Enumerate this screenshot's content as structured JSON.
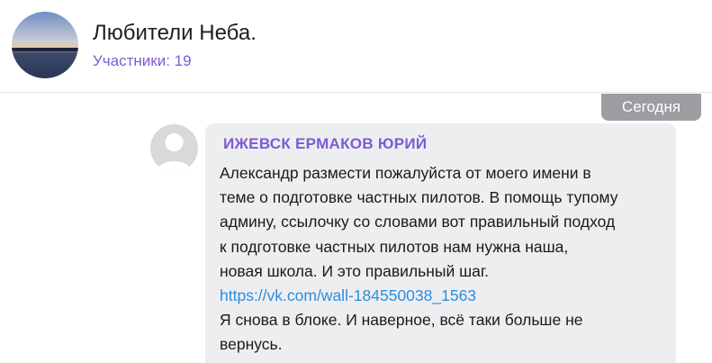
{
  "chat": {
    "title": "Любители Неба.",
    "subtitle": "Участники: 19",
    "avatar_icon": "sky-landscape-avatar"
  },
  "date_badge": "Сегодня",
  "message": {
    "sender": "ИЖЕВСК ЕРМАКОВ ЮРИЙ",
    "avatar_icon": "default-user-icon",
    "lines": [
      "Александр размести пожалуйста от моего имени в",
      "теме о подготовке частных пилотов. В помощь тупому",
      "админу, ссылочку со словами вот правильный подход",
      "к подготовке частных пилотов нам нужна наша,",
      "новая школа. И это правильный шаг."
    ],
    "link": "https://vk.com/wall-184550038_1563",
    "after_lines": [
      "Я снова в блоке. И наверное, всё таки больше не",
      "вернусь."
    ]
  },
  "colors": {
    "accent": "#7d5ad6",
    "link": "#2a8fdc",
    "bubble": "#eeeef1",
    "badge": "#9d9da1"
  }
}
